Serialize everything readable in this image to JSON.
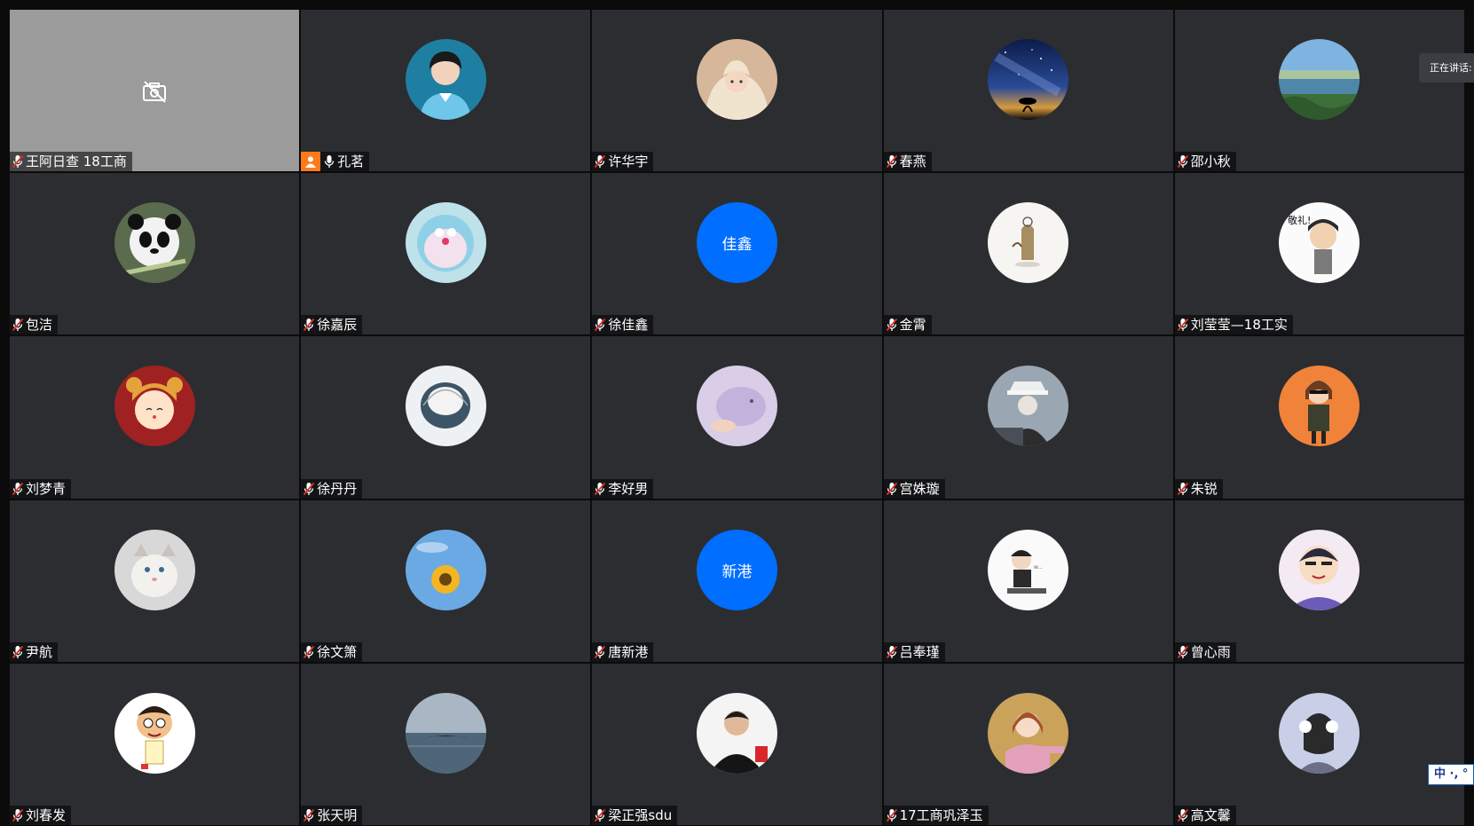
{
  "speaking_indicator": "正在讲话:",
  "ime_indicator": "中 ·, °",
  "participants": [
    {
      "name": "王阿日查 18工商",
      "avatar": "camera-off-icon",
      "mic": "muted"
    },
    {
      "name": "孔茗",
      "avatar": "woman-portrait",
      "mic": "on",
      "host": true
    },
    {
      "name": "许华宇",
      "avatar": "blanket-girl",
      "mic": "muted"
    },
    {
      "name": "春燕",
      "avatar": "starry-sky",
      "mic": "muted"
    },
    {
      "name": "邵小秋",
      "avatar": "lake-landscape",
      "mic": "muted"
    },
    {
      "name": "包洁",
      "avatar": "panda",
      "mic": "muted"
    },
    {
      "name": "徐嘉辰",
      "avatar": "doraemon",
      "mic": "muted"
    },
    {
      "name": "徐佳鑫",
      "initials": "佳鑫",
      "mic": "muted"
    },
    {
      "name": "金霄",
      "avatar": "cartoon-dog-sketch",
      "mic": "muted"
    },
    {
      "name": "刘莹莹—18工实",
      "avatar": "cartoon-salute-guy",
      "mic": "muted"
    },
    {
      "name": "刘梦青",
      "avatar": "mouse-hat-girl",
      "mic": "muted"
    },
    {
      "name": "徐丹丹",
      "avatar": "sketch-face",
      "mic": "muted"
    },
    {
      "name": "李好男",
      "avatar": "purple-bear",
      "mic": "muted"
    },
    {
      "name": "宫姝璇",
      "avatar": "anime-hat-figure",
      "mic": "muted"
    },
    {
      "name": "朱锐",
      "avatar": "cartoon-sunglasses-girl",
      "mic": "muted"
    },
    {
      "name": "尹航",
      "avatar": "cat",
      "mic": "muted"
    },
    {
      "name": "徐文箫",
      "avatar": "sunflower-sky",
      "mic": "muted"
    },
    {
      "name": "唐新港",
      "initials": "新港",
      "mic": "muted"
    },
    {
      "name": "吕奉瑾",
      "avatar": "sitting-cap-figure",
      "mic": "muted"
    },
    {
      "name": "曾心雨",
      "avatar": "crayon-shin",
      "mic": "muted"
    },
    {
      "name": "刘春发",
      "avatar": "cartoon-boy",
      "mic": "muted"
    },
    {
      "name": "张天明",
      "avatar": "whale-tail-sea",
      "mic": "muted"
    },
    {
      "name": "梁正强sdu",
      "avatar": "man-portrait",
      "mic": "muted"
    },
    {
      "name": "17工商巩泽玉",
      "avatar": "anime-girl",
      "mic": "muted"
    },
    {
      "name": "高文馨",
      "avatar": "earmuff-girl",
      "mic": "muted"
    }
  ]
}
